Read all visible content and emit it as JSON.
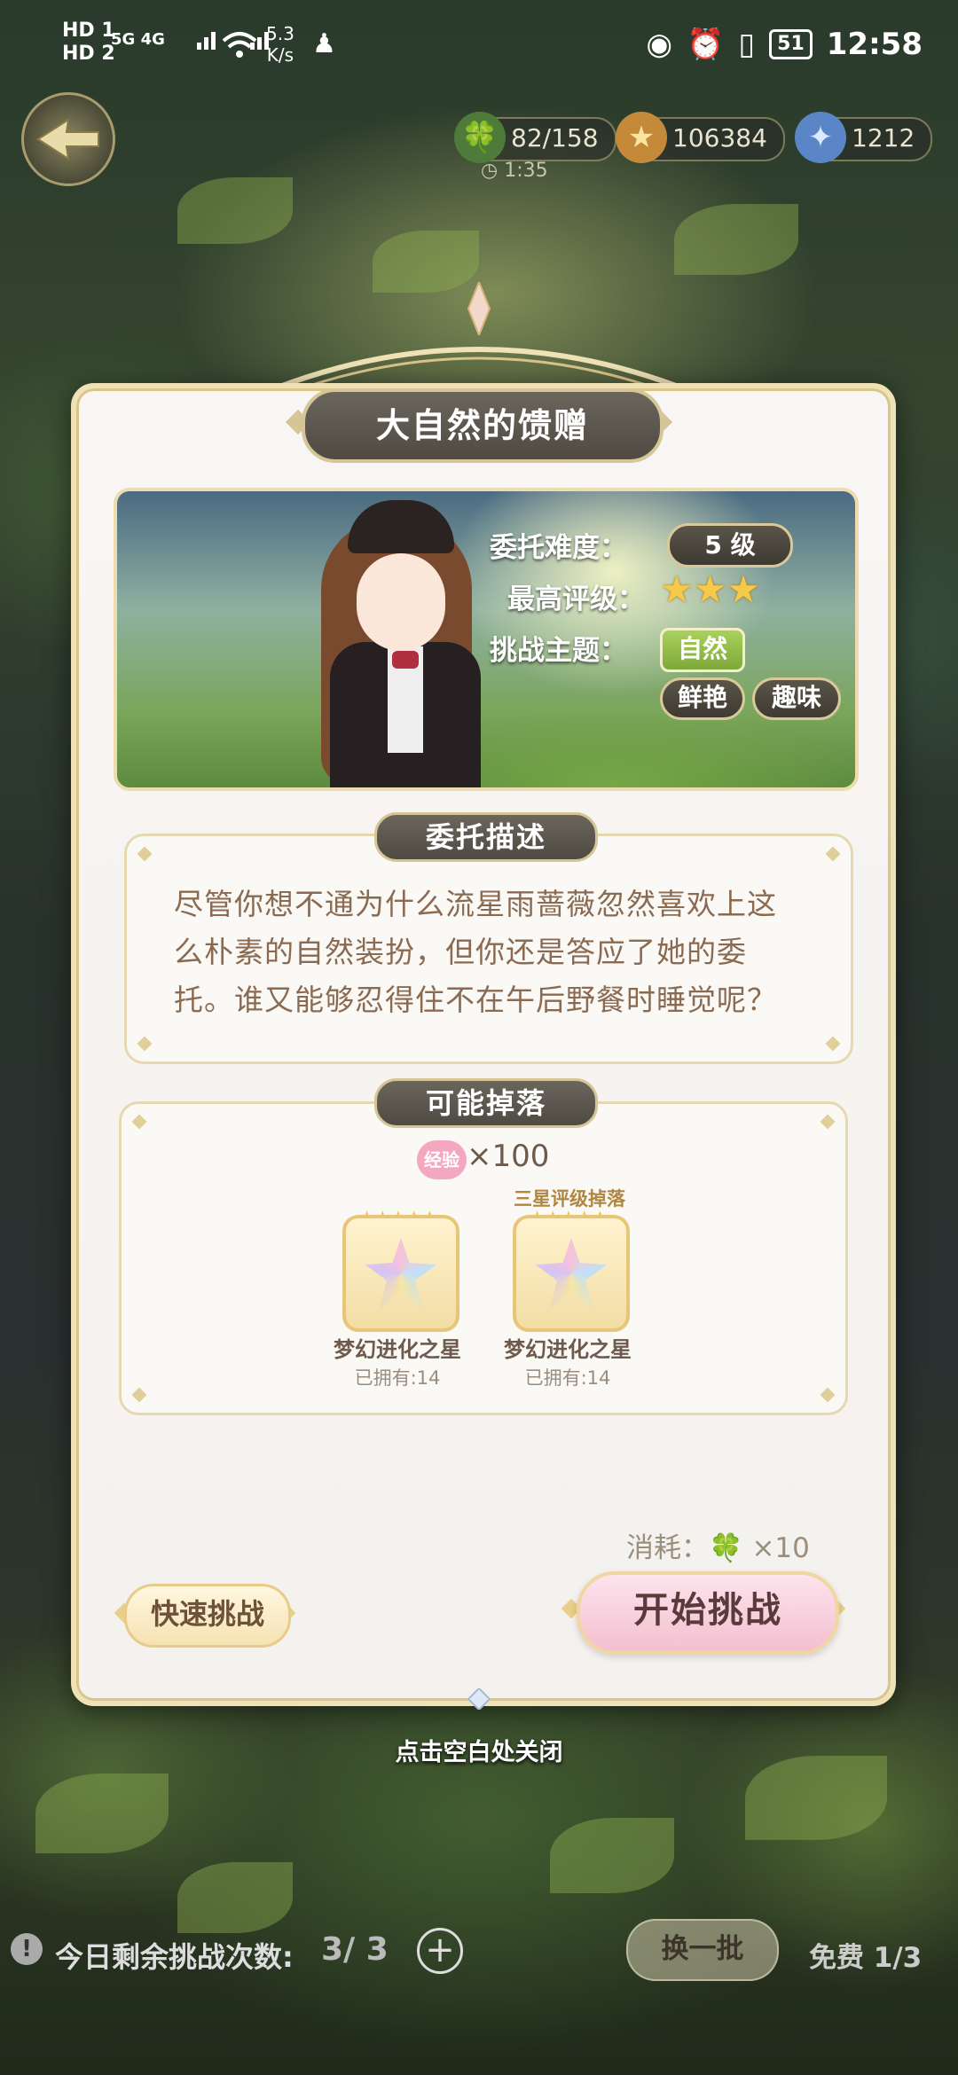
{
  "status_bar": {
    "hd1": "HD 1",
    "hd2": "HD 2",
    "net": "5G  4G",
    "speed_value": "5.3",
    "speed_unit": "K/s",
    "battery": "51",
    "time": "12:58"
  },
  "hud": {
    "clover": "82/158",
    "timer": "1:35",
    "coins": "106384",
    "gems": "1212"
  },
  "dialog": {
    "title": "大自然的馈赠",
    "difficulty_label": "委托难度：",
    "difficulty_value": "5 级",
    "rating_label": "最高评级：",
    "rating_stars": "★★★",
    "theme_label": "挑战主题：",
    "themes": [
      "自然",
      "鲜艳",
      "趣味"
    ],
    "desc_title": "委托描述",
    "description": "尽管你想不通为什么流星雨蔷薇忽然喜欢上这么朴素的自然装扮，但你还是答应了她的委托。谁又能够忍得住不在午后野餐时睡觉呢？",
    "drops_title": "可能掉落",
    "exp_badge": "经验",
    "exp_amount": "×100",
    "three_star_tag": "三星评级掉落",
    "items": [
      {
        "stars": "★★★★★",
        "name": "梦幻进化之星",
        "owned": "已拥有:14"
      },
      {
        "stars": "★★★★★",
        "name": "梦幻进化之星",
        "owned": "已拥有:14"
      }
    ],
    "cost": "消耗：🍀 ×10",
    "quick_button": "快速挑战",
    "start_button": "开始挑战"
  },
  "close_hint": "点击空白处关闭",
  "bottom": {
    "remaining_label": "今日剩余挑战次数:",
    "remaining_value": "3/ 3",
    "plus": "+",
    "swap_button": "换一批",
    "free": "免费 1/3"
  },
  "colors": {
    "title_pill": "#4f4a42",
    "start_button": "#f4bfd0",
    "quick_button": "#f6e2b3",
    "text_brown": "#8b6a52"
  }
}
